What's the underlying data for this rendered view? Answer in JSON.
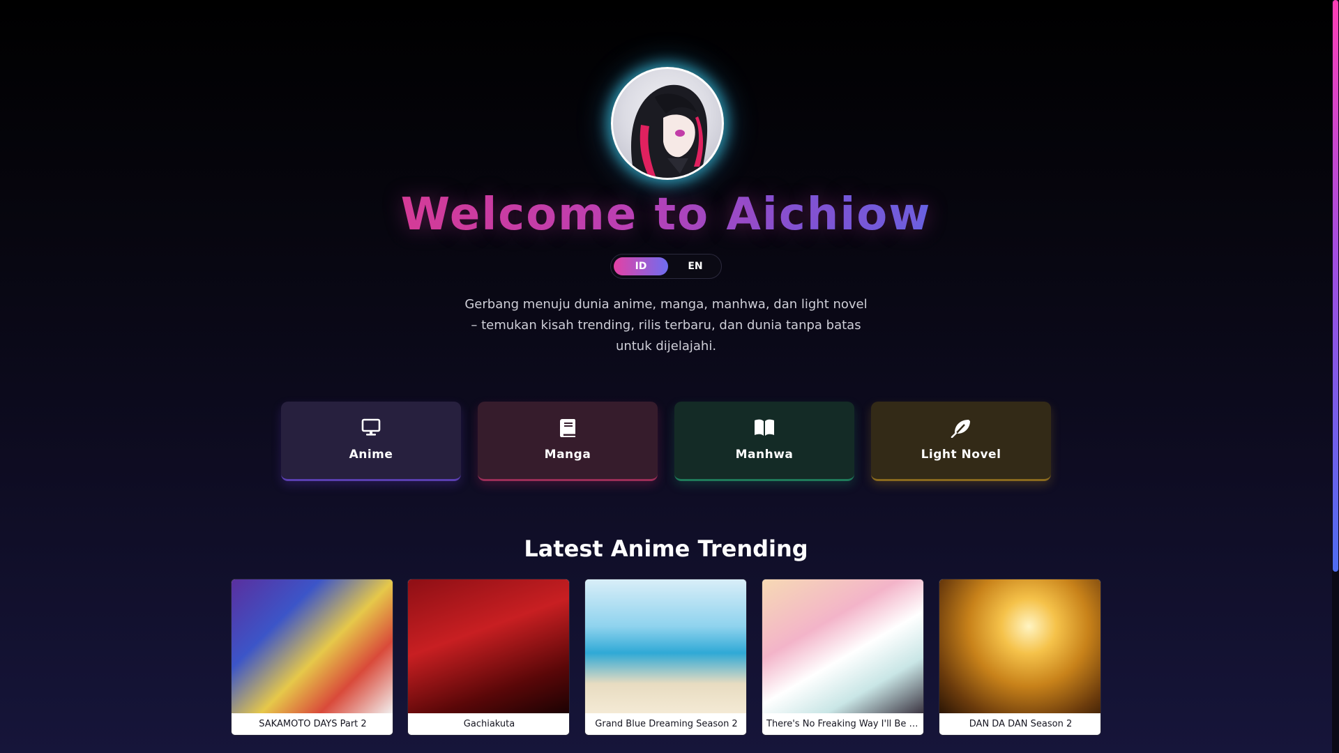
{
  "hero": {
    "title": "Welcome to Aichiow",
    "tagline": "Gerbang menuju dunia anime, manga, manhwa, dan light novel – temukan kisah trending, rilis terbaru, dan dunia tanpa batas untuk dijelajahi."
  },
  "language": {
    "options": [
      "ID",
      "EN"
    ],
    "selected": "ID"
  },
  "categories": [
    {
      "label": "Anime",
      "icon": "tv-icon",
      "color": "#27203e"
    },
    {
      "label": "Manga",
      "icon": "book-icon",
      "color": "#361c2c"
    },
    {
      "label": "Manhwa",
      "icon": "open-book-icon",
      "color": "#142b26"
    },
    {
      "label": "Light Novel",
      "icon": "feather-icon",
      "color": "#332a17"
    }
  ],
  "trending": {
    "title": "Latest Anime Trending",
    "items": [
      {
        "title": "SAKAMOTO DAYS Part 2"
      },
      {
        "title": "Gachiakuta"
      },
      {
        "title": "Grand Blue Dreaming Season 2"
      },
      {
        "title": "There's No Freaking Way I'll Be Yo..."
      },
      {
        "title": "DAN DA DAN Season 2"
      }
    ]
  },
  "theme": {
    "accent_pink": "#e441a4",
    "accent_blue": "#6e6df0",
    "glow_cyan": "#40dcff"
  }
}
